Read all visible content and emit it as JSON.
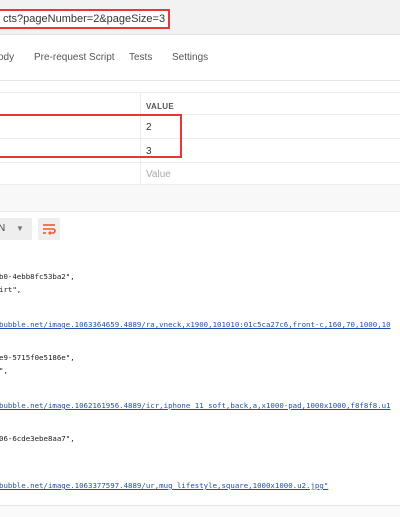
{
  "request": {
    "url_visible": "cts?pageNumber=2&pageSize=3"
  },
  "tabs": [
    {
      "label": "ody"
    },
    {
      "label": "Pre-request Script"
    },
    {
      "label": "Tests"
    },
    {
      "label": "Settings"
    }
  ],
  "params": {
    "header_value": "VALUE",
    "rows": [
      {
        "value": "2"
      },
      {
        "value": "3"
      }
    ],
    "value_placeholder": "Value"
  },
  "response": {
    "format_label": "N",
    "body_lines": [
      {
        "text": "b0-4ebb8fc53ba2\",",
        "link": false
      },
      {
        "text": "irt\",",
        "link": false
      },
      {
        "text": "bubble.net/image.1063364659.4889/ra,vneck,x1900,101010:01c5ca27c6,front-c,160,70,1000,10",
        "link": true
      },
      {
        "text": "e9-5715f0e5186e\",",
        "link": false
      },
      {
        "text": "\",",
        "link": false
      },
      {
        "text": "bubble.net/image.1062161956.4889/icr,iphone_11_soft,back,a,x1000-pad,1000x1000,f8f8f8.u1",
        "link": true
      },
      {
        "text": "06-6cde3ebe8aa7\",",
        "link": false
      },
      {
        "text": "bubble.net/image.1063377597.4889/ur,mug_lifestyle,square,1000x1000.u2.jpg\"",
        "link": true
      }
    ]
  },
  "colors": {
    "highlight_border": "#e53935",
    "wrap_icon": "#f05a28",
    "link": "#1f4fb0"
  }
}
